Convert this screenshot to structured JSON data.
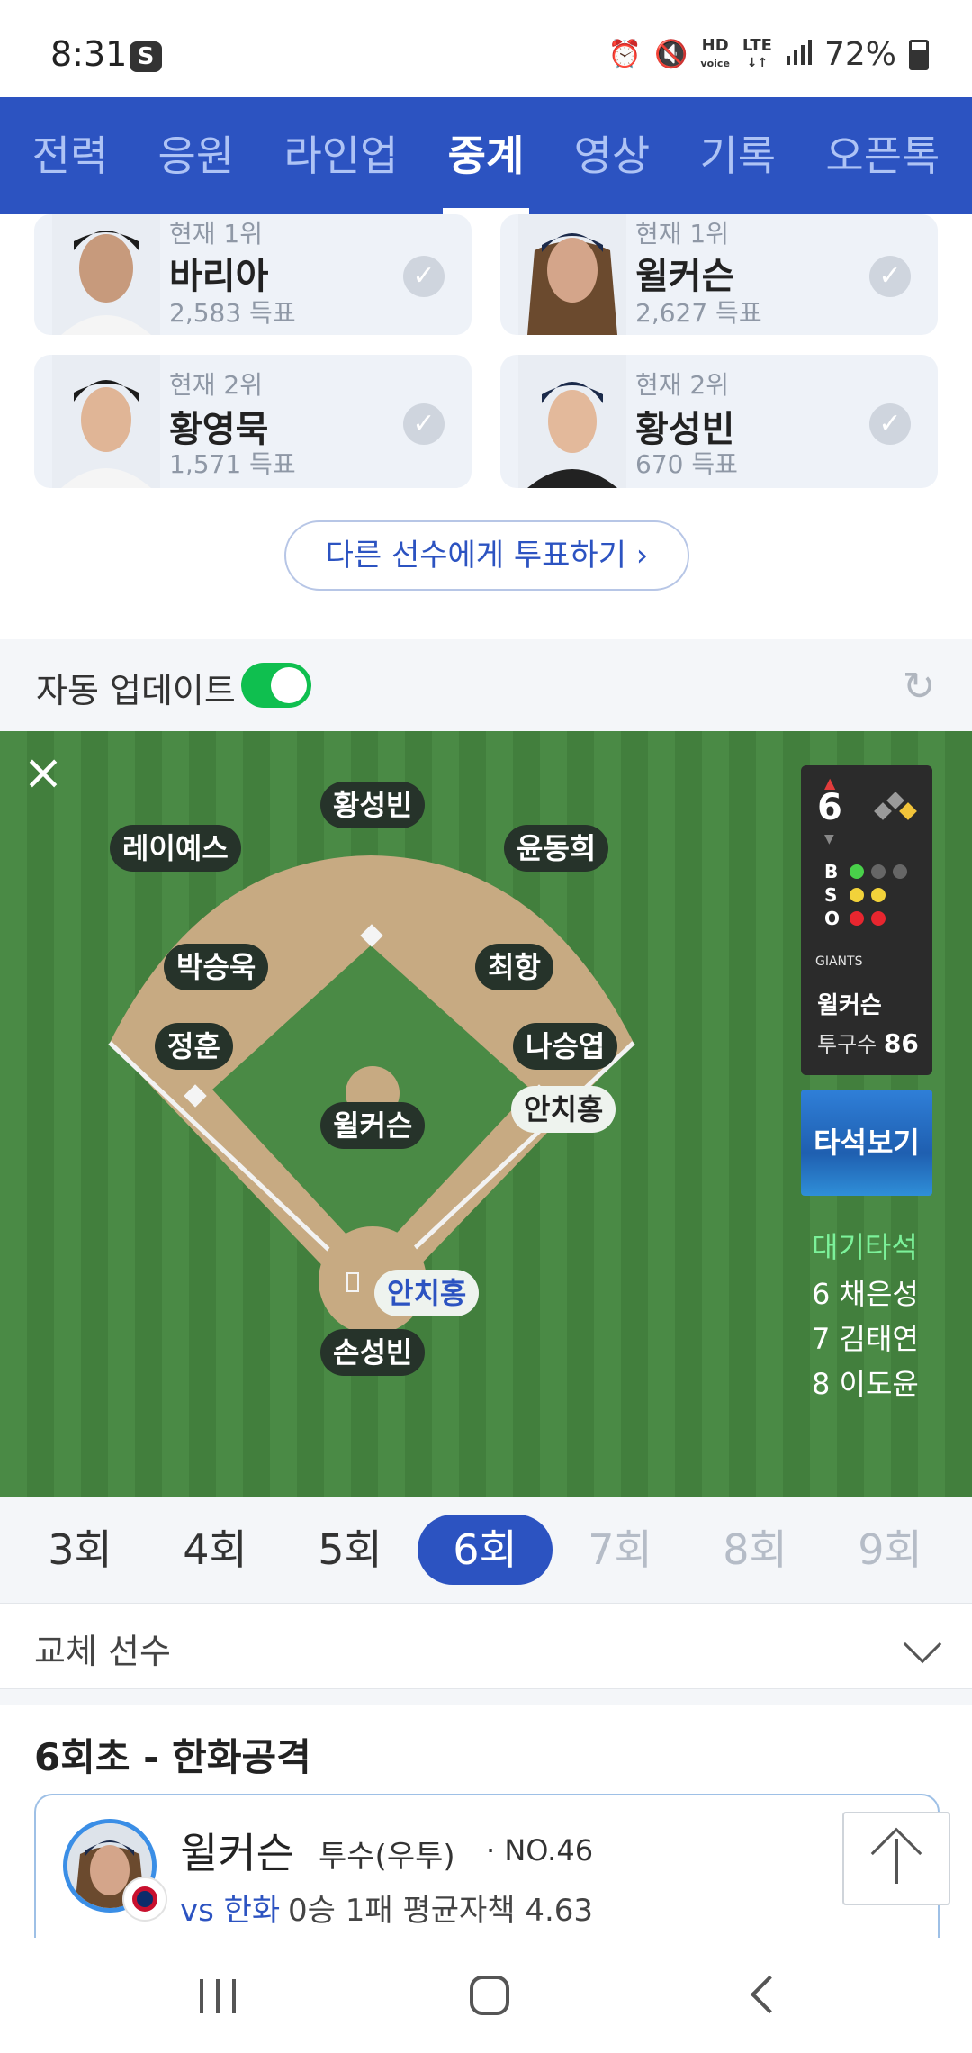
{
  "status_bar": {
    "time": "8:31",
    "app_icon": "S",
    "hd_label": "HD",
    "voice_label": "voice",
    "lte_label": "LTE",
    "battery": "72%"
  },
  "tabs": [
    "전력",
    "응원",
    "라인업",
    "중계",
    "영상",
    "기록",
    "오픈톡"
  ],
  "active_tab": "중계",
  "vote_cards": [
    {
      "rank": "현재 1위",
      "name": "바리아",
      "votes": "2,583 득표"
    },
    {
      "rank": "현재 1위",
      "name": "윌커슨",
      "votes": "2,627 득표"
    },
    {
      "rank": "현재 2위",
      "name": "황영묵",
      "votes": "1,571 득표"
    },
    {
      "rank": "현재 2위",
      "name": "황성빈",
      "votes": "670 득표"
    }
  ],
  "vote_button": "다른 선수에게 투표하기 ›",
  "auto_update": {
    "label": "자동 업데이트",
    "enabled": true
  },
  "field": {
    "fielders": {
      "center": "황성빈",
      "left": "레이예스",
      "right": "윤동희",
      "shortstop": "박승욱",
      "second": "최항",
      "third": "정훈",
      "first": "나승엽",
      "pitcher": "윌커슨",
      "catcher": "손성빈"
    },
    "runner_first": "안치홍",
    "batter": "안치홍"
  },
  "scoreboard": {
    "inning": "6",
    "ball_label": "B",
    "strike_label": "S",
    "out_label": "O",
    "balls": 1,
    "strikes": 2,
    "outs": 2,
    "team_logo": "GIANTS",
    "pitcher": "윌커슨",
    "pitch_count_label": "투구수",
    "pitch_count": "86"
  },
  "at_bat_button": "타석보기",
  "on_deck": {
    "title": "대기타석",
    "batters": [
      "6 채은성",
      "7 김태연",
      "8 이도윤"
    ]
  },
  "innings": [
    "3회",
    "4회",
    "5회",
    "6회",
    "7회",
    "8회",
    "9회"
  ],
  "active_inning": "6회",
  "substitution": "교체 선수",
  "section_title": "6회초 - 한화공격",
  "pitcher_card": {
    "name": "윌커슨",
    "position": "투수(우투)",
    "number": "· NO.46",
    "vs": "vs 한화",
    "record": "0승 1패 평균자책 4.63"
  },
  "colors": {
    "brand": "#2c53c1",
    "field": "#4a8a45",
    "dirt": "#c7aa82",
    "toggle_on": "#0fbf4f"
  }
}
